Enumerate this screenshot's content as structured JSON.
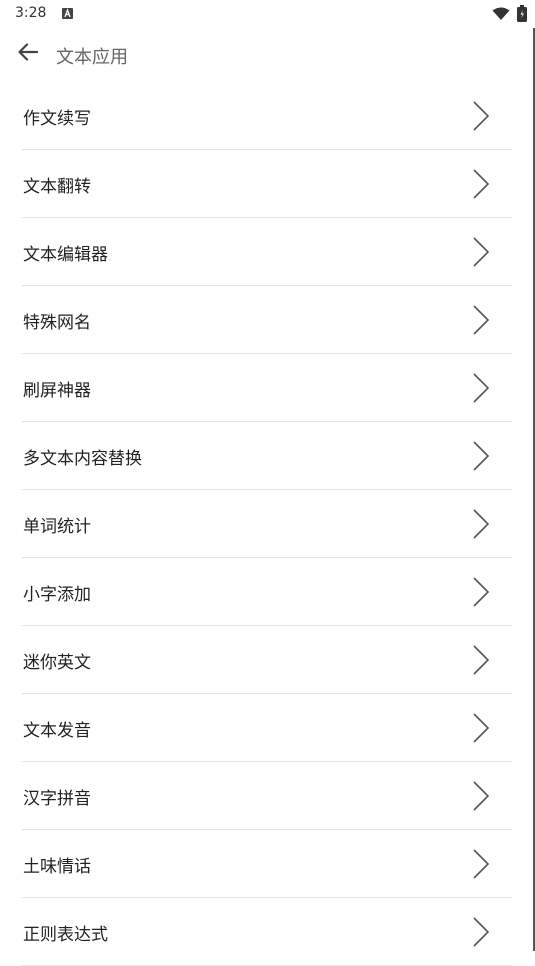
{
  "status_bar": {
    "time": "3:28",
    "icons": [
      "a-notification-icon",
      "wifi-icon",
      "battery-icon"
    ]
  },
  "header": {
    "back_icon": "arrow-left-icon",
    "title": "文本应用"
  },
  "list": {
    "chevron_icon": "chevron-right-icon",
    "items": [
      {
        "label": "作文续写"
      },
      {
        "label": "文本翻转"
      },
      {
        "label": "文本编辑器"
      },
      {
        "label": "特殊网名"
      },
      {
        "label": "刷屏神器"
      },
      {
        "label": "多文本内容替换"
      },
      {
        "label": "单词统计"
      },
      {
        "label": "小字添加"
      },
      {
        "label": "迷你英文"
      },
      {
        "label": "文本发音"
      },
      {
        "label": "汉字拼音"
      },
      {
        "label": "土味情话"
      },
      {
        "label": "正则表达式"
      }
    ]
  },
  "colors": {
    "background": "#ffffff",
    "text": "#222222",
    "title": "#666666",
    "divider": "#e3e3e3",
    "chevron": "#555555"
  }
}
